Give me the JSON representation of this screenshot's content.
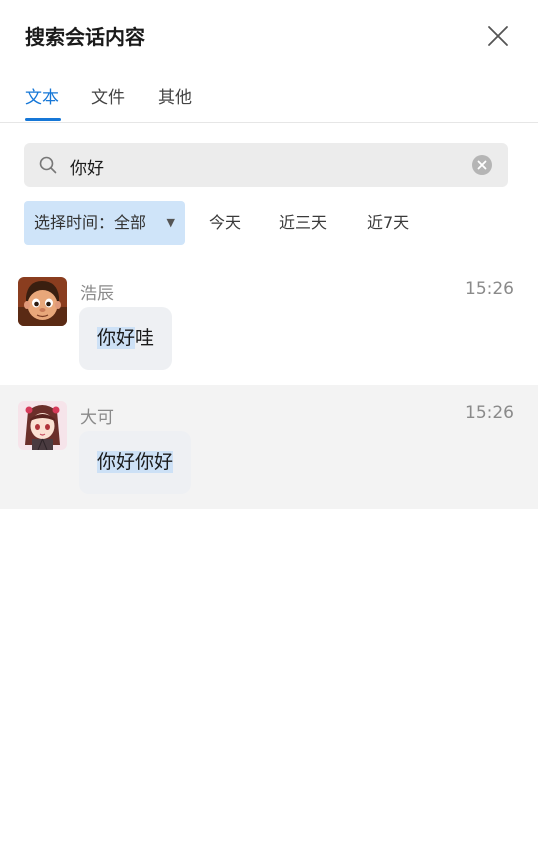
{
  "header": {
    "title": "搜索会话内容"
  },
  "tabs": [
    {
      "label": "文本",
      "active": true
    },
    {
      "label": "文件",
      "active": false
    },
    {
      "label": "其他",
      "active": false
    }
  ],
  "search": {
    "value": "你好",
    "placeholder": ""
  },
  "filters": {
    "dropdown_label": "选择时间：全部",
    "options": [
      "今天",
      "近三天",
      "近7天"
    ]
  },
  "messages": [
    {
      "sender": "浩辰",
      "time": "15:26",
      "highlight": "你好",
      "rest": "哇"
    },
    {
      "sender": "大可",
      "time": "15:26",
      "highlight": "你好你好",
      "rest": ""
    }
  ],
  "colors": {
    "accent": "#1677d7",
    "highlight_bg": "#cde1f6",
    "dropdown_bg": "#cfe4f9",
    "selected_row_bg": "#f3f3f3"
  }
}
